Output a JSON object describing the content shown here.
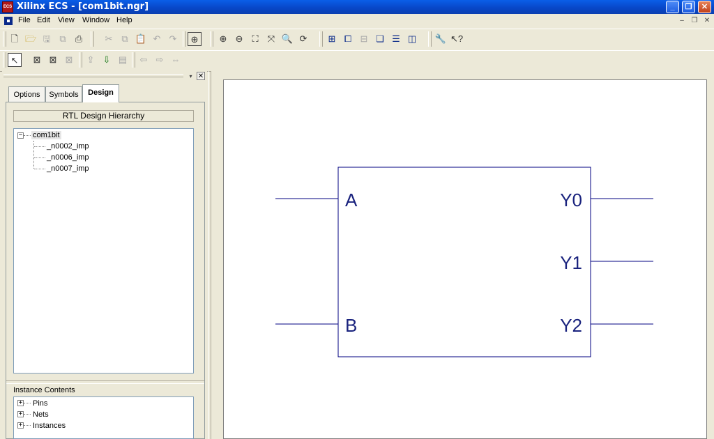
{
  "window": {
    "title": "Xilinx ECS - [com1bit.ngr]",
    "app_icon": "ecs-app-icon",
    "controls": [
      "minimize-icon",
      "restore-icon",
      "close-icon"
    ],
    "accent": "#0a5ee8"
  },
  "menu": [
    "File",
    "Edit",
    "View",
    "Window",
    "Help"
  ],
  "panel": {
    "tabs": [
      "Options",
      "Symbols",
      "Design"
    ],
    "active_tab": "Design",
    "hierarchy_title": "RTL Design Hierarchy",
    "tree": {
      "root": "com1bit",
      "children": [
        "_n0002_imp",
        "_n0006_imp",
        "_n0007_imp"
      ]
    },
    "instance_title": "Instance Contents",
    "instance_items": [
      "Pins",
      "Nets",
      "Instances"
    ]
  },
  "schematic": {
    "inputs": [
      "A",
      "B"
    ],
    "outputs": [
      "Y0",
      "Y1",
      "Y2"
    ],
    "line_color": "#000080",
    "text_color": "#1a237e"
  }
}
